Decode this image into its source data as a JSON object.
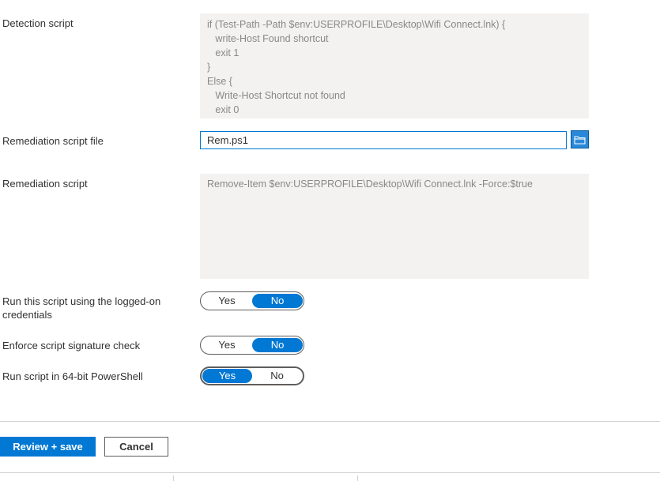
{
  "detection": {
    "label": "Detection script",
    "code": "if (Test-Path -Path $env:USERPROFILE\\Desktop\\Wifi Connect.lnk) {\n   write-Host Found shortcut\n   exit 1\n}\nElse {\n   Write-Host Shortcut not found\n   exit 0"
  },
  "remediation_file": {
    "label": "Remediation script file",
    "value": "Rem.ps1",
    "browse_icon": "folder-icon"
  },
  "remediation": {
    "label": "Remediation script",
    "code": "Remove-Item $env:USERPROFILE\\Desktop\\Wifi Connect.lnk -Force:$true"
  },
  "toggles": [
    {
      "label": "Run this script using the logged-on credentials",
      "yes": "Yes",
      "no": "No",
      "selected": "No"
    },
    {
      "label": "Enforce script signature check",
      "yes": "Yes",
      "no": "No",
      "selected": "No"
    },
    {
      "label": "Run script in 64-bit PowerShell",
      "yes": "Yes",
      "no": "No",
      "selected": "Yes"
    }
  ],
  "footer": {
    "primary_label": "Review + save",
    "cancel_label": "Cancel"
  },
  "colors": {
    "accent": "#0078d4",
    "code_bg": "#f3f2f1"
  }
}
